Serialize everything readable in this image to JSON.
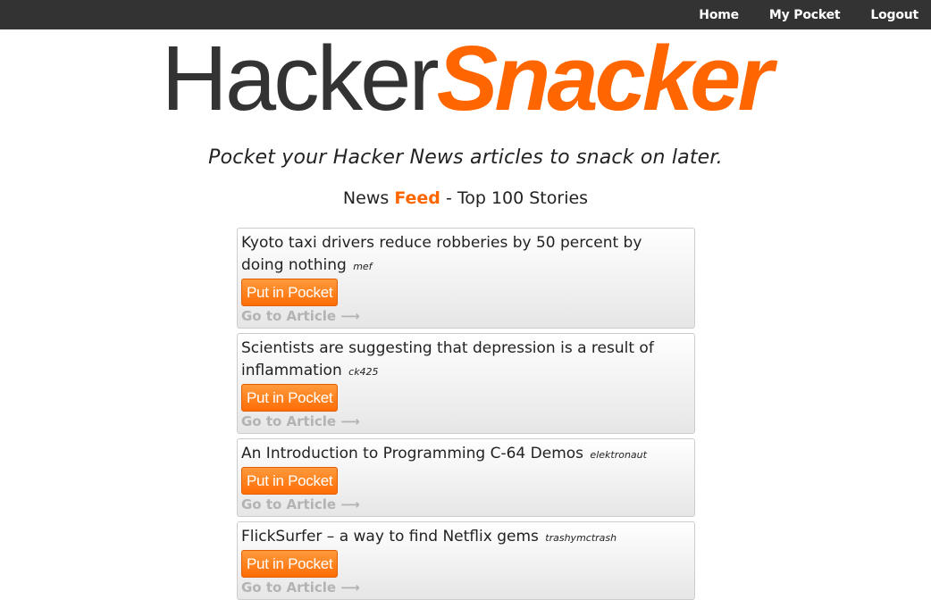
{
  "nav": {
    "items": [
      {
        "label": "Home"
      },
      {
        "label": "My Pocket"
      },
      {
        "label": "Logout"
      }
    ]
  },
  "logo": {
    "part1": "Hacker",
    "part2": "Snacker"
  },
  "tagline": "Pocket your Hacker News articles to snack on later.",
  "feed": {
    "prefix": "News ",
    "accent": "Feed",
    "suffix": " - Top 100 Stories"
  },
  "stories": [
    {
      "title": "Kyoto taxi drivers reduce robberies by 50 percent by doing nothing",
      "author": "mef",
      "button": "Put in Pocket",
      "link": "Go to Article ⟶"
    },
    {
      "title": "Scientists are suggesting that depression is a result of inflammation",
      "author": "ck425",
      "button": "Put in Pocket",
      "link": "Go to Article ⟶"
    },
    {
      "title": "An Introduction to Programming C-64 Demos",
      "author": "elektronaut",
      "button": "Put in Pocket",
      "link": "Go to Article ⟶"
    },
    {
      "title": "FlickSurfer – a way to find Netflix gems",
      "author": "trashymctrash",
      "button": "Put in Pocket",
      "link": "Go to Article ⟶"
    }
  ],
  "colors": {
    "accent": "#ff6600",
    "topbar": "#333333"
  }
}
